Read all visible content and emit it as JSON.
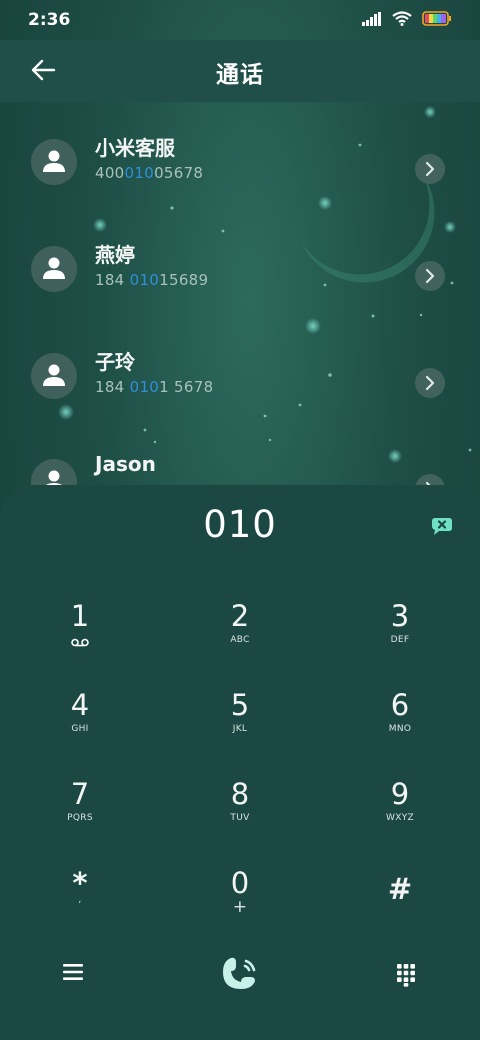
{
  "status": {
    "time": "2:36"
  },
  "header": {
    "title": "通话"
  },
  "contacts": [
    {
      "name": "小米客服",
      "num_pre": "400",
      "num_hl": "010",
      "num_post": "05678"
    },
    {
      "name": "燕婷",
      "num_pre": "184 ",
      "num_hl": "010",
      "num_post": "15689"
    },
    {
      "name": "子玲",
      "num_pre": "184 ",
      "num_hl": "010",
      "num_post": "1 5678"
    },
    {
      "name": "Jason",
      "num_pre": "",
      "num_hl": "",
      "num_post": ""
    }
  ],
  "dialpad": {
    "input": "010",
    "keys": [
      {
        "digit": "1",
        "letters": ""
      },
      {
        "digit": "2",
        "letters": "ABC"
      },
      {
        "digit": "3",
        "letters": "DEF"
      },
      {
        "digit": "4",
        "letters": "GHI"
      },
      {
        "digit": "5",
        "letters": "JKL"
      },
      {
        "digit": "6",
        "letters": "MNO"
      },
      {
        "digit": "7",
        "letters": "PQRS"
      },
      {
        "digit": "8",
        "letters": "TUV"
      },
      {
        "digit": "9",
        "letters": "WXYZ"
      },
      {
        "digit": "*",
        "letters": ","
      },
      {
        "digit": "0",
        "letters": "+"
      },
      {
        "digit": "#",
        "letters": ""
      }
    ]
  },
  "icons": [
    "back-arrow-icon",
    "signal-icon",
    "wifi-icon",
    "battery-icon",
    "chevron-right-icon",
    "person-icon",
    "voicemail-icon",
    "backspace-icon",
    "menu-icon",
    "call-icon",
    "keypad-icon"
  ],
  "colors": {
    "accent": "#2f8fd9",
    "header_bg": "#1f4f48",
    "dialpad_bg": "#1c4844"
  }
}
